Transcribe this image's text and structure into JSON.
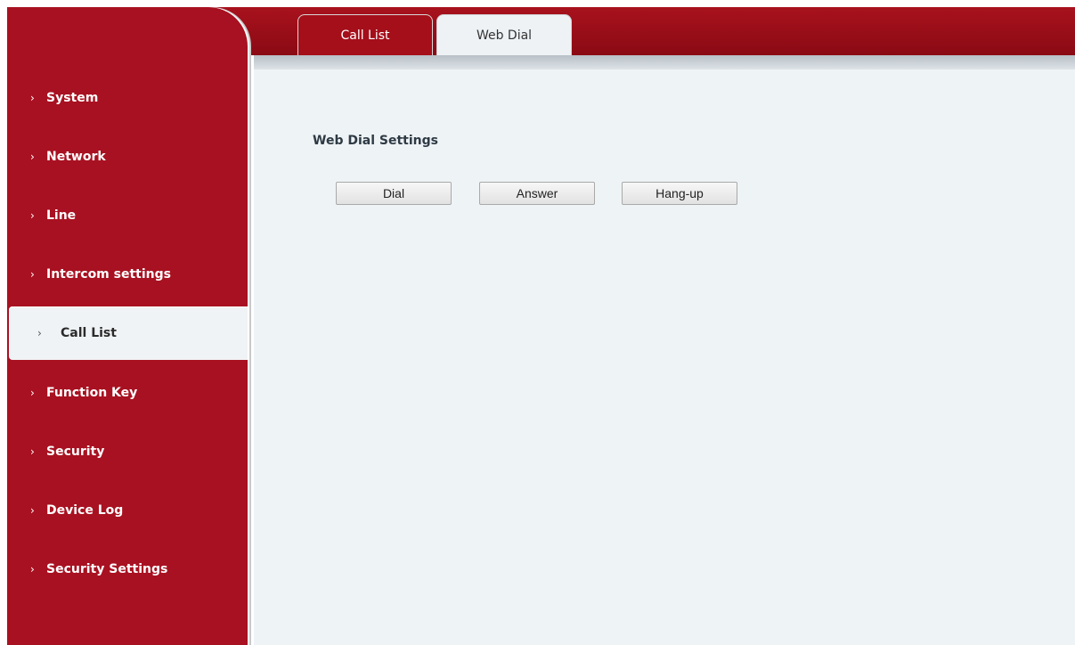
{
  "tabs": [
    {
      "label": "Call List",
      "active": true
    },
    {
      "label": "Web Dial",
      "active": false
    }
  ],
  "sidebar": {
    "items": [
      {
        "label": "System"
      },
      {
        "label": "Network"
      },
      {
        "label": "Line"
      },
      {
        "label": "Intercom settings"
      },
      {
        "label": "Call List"
      },
      {
        "label": "Function Key"
      },
      {
        "label": "Security"
      },
      {
        "label": "Device Log"
      },
      {
        "label": "Security Settings"
      }
    ],
    "active_index": 4,
    "chevron": "›"
  },
  "main": {
    "section_title": "Web Dial Settings",
    "buttons": {
      "dial": "Dial",
      "answer": "Answer",
      "hangup": "Hang-up"
    }
  },
  "colors": {
    "accent_red": "#a81121",
    "content_bg": "#eef3f6"
  }
}
